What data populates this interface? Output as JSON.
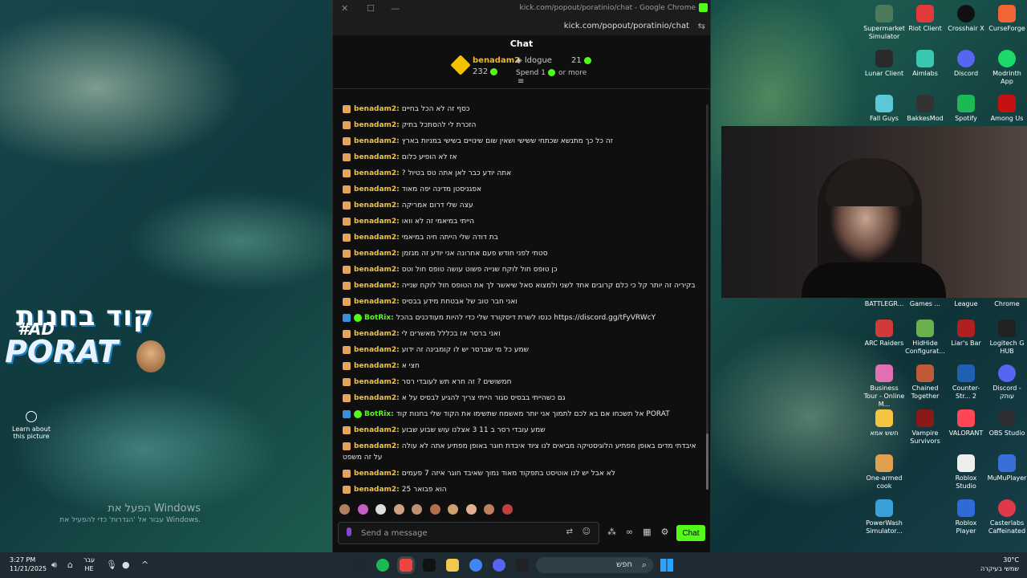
{
  "window": {
    "title": "kick.com/popout/poratinio/chat - Google Chrome",
    "url": "kick.com/popout/poratinio/chat",
    "chat_header": "Chat"
  },
  "leaderboard": {
    "first_user": "benadam2",
    "first_points": "232",
    "second_user": "ldogue",
    "second_points": "21",
    "spend_label": "Spend 1",
    "spend_suffix": "or more"
  },
  "messages": [
    {
      "user": "benadam2:",
      "text": "כסף זה לא הכל בחיים",
      "bot": false
    },
    {
      "user": "benadam2:",
      "text": "הזכרת לי להסתכל בתיק",
      "bot": false
    },
    {
      "user": "benadam2:",
      "text": "זה כל כך מתנשא שכתחי ששישי ושאין שום שינויים בשישי במניות בארץ",
      "bot": false
    },
    {
      "user": "benadam2:",
      "text": "אז לא הופיע כלום",
      "bot": false
    },
    {
      "user": "benadam2:",
      "text": "? אתה יודע כבר לאן אתה טס בטיול",
      "bot": false
    },
    {
      "user": "benadam2:",
      "text": "אפגניסטן מדינה יפה מאוד",
      "bot": false
    },
    {
      "user": "benadam2:",
      "text": "עצה שלי דרום אמריקה",
      "bot": false
    },
    {
      "user": "benadam2:",
      "text": "הייתי במיאמי זה לא וואו",
      "bot": false
    },
    {
      "user": "benadam2:",
      "text": "בת דודה שלי הייתה חיה במיאמי",
      "bot": false
    },
    {
      "user": "benadam2:",
      "text": "סטתי לפני חודש פעם אחרונה אני יודע זה מגזמן",
      "bot": false
    },
    {
      "user": "benadam2:",
      "text": "כן טופס חול לוקח שנייה פשוט עושה טופס חול וטס",
      "bot": false
    },
    {
      "user": "benadam2:",
      "text": "בקיריה זה יותר קל כי כלם קרובים אחד לשני ולמצוא סאל שיאשר לך את הטופס חול לוקח שנייה",
      "bot": false
    },
    {
      "user": "benadam2:",
      "text": "ואני חבר טוב של אבטחת מידע בבסיס",
      "bot": false
    },
    {
      "user": "BotRix:",
      "text": "כנסו לשרת דיסקורד שלי כדי להיות מעודכנים בהכל https://discord.gg/tFyVRWcY",
      "bot": true
    },
    {
      "user": "benadam2:",
      "text": "ואני ברסר אז בכללל מאשרים לי",
      "bot": false
    },
    {
      "user": "benadam2:",
      "text": "שמע כל מי שברסר יש לו קומבינה זה ידוע",
      "bot": false
    },
    {
      "user": "benadam2:",
      "text": "חצי א",
      "bot": false
    },
    {
      "user": "benadam2:",
      "text": "חמשושים ? זה חרא תש לעובדי רסר",
      "bot": false
    },
    {
      "user": "benadam2:",
      "text": "גם כשהייתי בבסיס סגור הייתי צריך להגיע לבסיס על א",
      "bot": false
    },
    {
      "user": "BotRix:",
      "text": "אל תשכחו אם בא לכם לתמוך אני יותר מאשמח שתשימו את הקוד שלי בחנות קוד PORAT",
      "bot": true
    },
    {
      "user": "benadam2:",
      "text": "שמע עובדי רסר ב 11 3 אצלנו עוש שבוע שבוע",
      "bot": false
    },
    {
      "user": "benadam2:",
      "text": "איבדתי מדים באופן מפתיע הלוגיסטיקה מביאים לנו ציוד איבדת חוגר באופן מפתיע אתה לא עולה על זה משפט",
      "bot": false
    },
    {
      "user": "benadam2:",
      "text": "לא אבל יש לנו אוטיסט בתפקוד מאוד נמוך שאיבד חוגר איזה 7 פעמים",
      "bot": false
    },
    {
      "user": "benadam2:",
      "text": "הוא פבואר 25",
      "bot": false
    }
  ],
  "input": {
    "placeholder": "Send a message",
    "send_label": "Chat"
  },
  "promo": {
    "line1": "קוד בחנות",
    "tag": "#AD",
    "line2": "PORAT"
  },
  "learn_more": "Learn about this picture",
  "activation": {
    "title": "הפעל את Windows",
    "subtitle": "עבור אל 'הגדרות' כדי להפעיל את Windows."
  },
  "desktop_icons": {
    "col_a": [
      "Supermarket Simulator",
      "Lunar Client",
      "Fall Guys",
      "BATTLEGR...",
      "ARC Raiders",
      "Business Tour - Online M...",
      "חשש אמא",
      "One-armed cook",
      "PowerWash Simulator..."
    ],
    "col_b": [
      "Riot Client",
      "Aimlabs",
      "BakkesMod",
      "Games ...",
      "HidHide Configurat...",
      "Chained Together",
      "Vampire Survivors",
      "Roblox Studio",
      "Roblox Player"
    ],
    "col_c": [
      "Crosshair X",
      "Discord",
      "Spotify",
      "League",
      "Liar's Bar",
      "Counter-Str... 2",
      "VALORANT",
      "MuMuPlayer"
    ],
    "col_d": [
      "CurseForge",
      "Modrinth App",
      "Among Us",
      "Chrome",
      "Logitech G HUB",
      "Discord - עותק",
      "OBS Studio",
      "Casterlabs Caffeinated"
    ]
  },
  "taskbar": {
    "time": "3:27 PM",
    "date": "11/21/2025",
    "lang_top": "עבר",
    "lang_bottom": "HE",
    "search_label": "חפש",
    "temp": "30°C",
    "weather": "שמשי בעיקרה"
  },
  "colors": {
    "kick_green": "#53fc18",
    "gold": "#f3c23a"
  }
}
